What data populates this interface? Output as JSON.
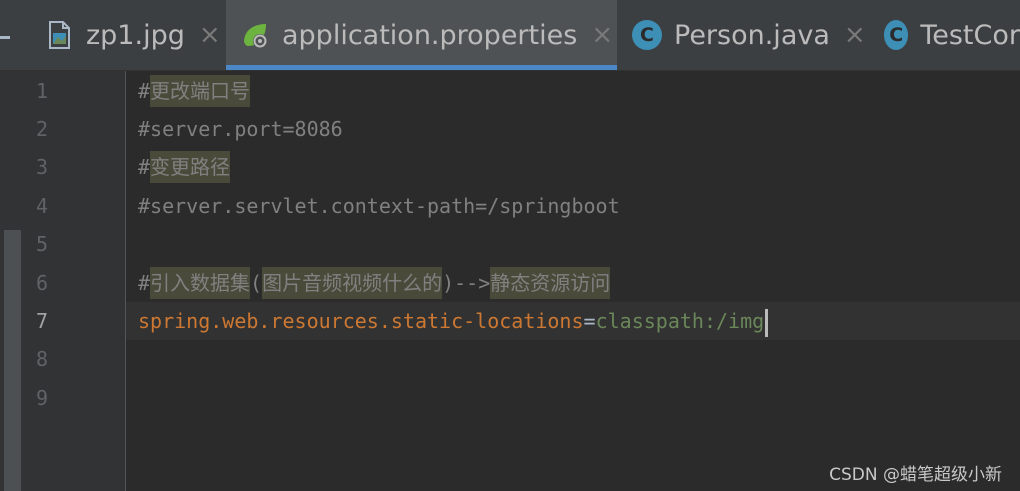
{
  "tabs": [
    {
      "label": "zp1.jpg",
      "icon": "image-file-icon",
      "closable": true,
      "active": false
    },
    {
      "label": "application.properties",
      "icon": "spring-properties-icon",
      "closable": true,
      "active": true
    },
    {
      "label": "Person.java",
      "icon": "java-class-icon",
      "icon_letter": "C",
      "closable": true,
      "active": false
    },
    {
      "label": "TestCor",
      "icon": "java-class-icon",
      "icon_letter": "C",
      "closable": false,
      "active": false
    }
  ],
  "close_glyph": "×",
  "gutter": {
    "line_numbers": [
      "1",
      "2",
      "3",
      "4",
      "5",
      "6",
      "7",
      "8",
      "9"
    ],
    "current_line": "7"
  },
  "code": {
    "line1": {
      "hash": "#",
      "text": "更改端口号"
    },
    "line2": {
      "text": "#server.port=8086"
    },
    "line3": {
      "hash": "#",
      "text": "变更路径"
    },
    "line4": {
      "text": "#server.servlet.context-path=/springboot"
    },
    "line6": {
      "hash": "#",
      "part1": "引入数据集",
      "paren_open": "(",
      "part2": "图片音频视频什么的",
      "arrow": ")-->",
      "part3": "静态资源访问"
    },
    "line7": {
      "key": "spring.web.resources.static-locations",
      "eq": "=",
      "value": "classpath:/img"
    }
  },
  "watermark": "CSDN @蜡笔超级小新",
  "colors": {
    "background": "#2b2b2b",
    "tab_bar": "#3c3f41",
    "tab_active_underline": "#4a88c7",
    "comment": "#808080",
    "property_key": "#cc7832",
    "property_value": "#6a8759",
    "java_class_icon": "#3d8fb6",
    "spring_leaf": "#6db33f"
  }
}
